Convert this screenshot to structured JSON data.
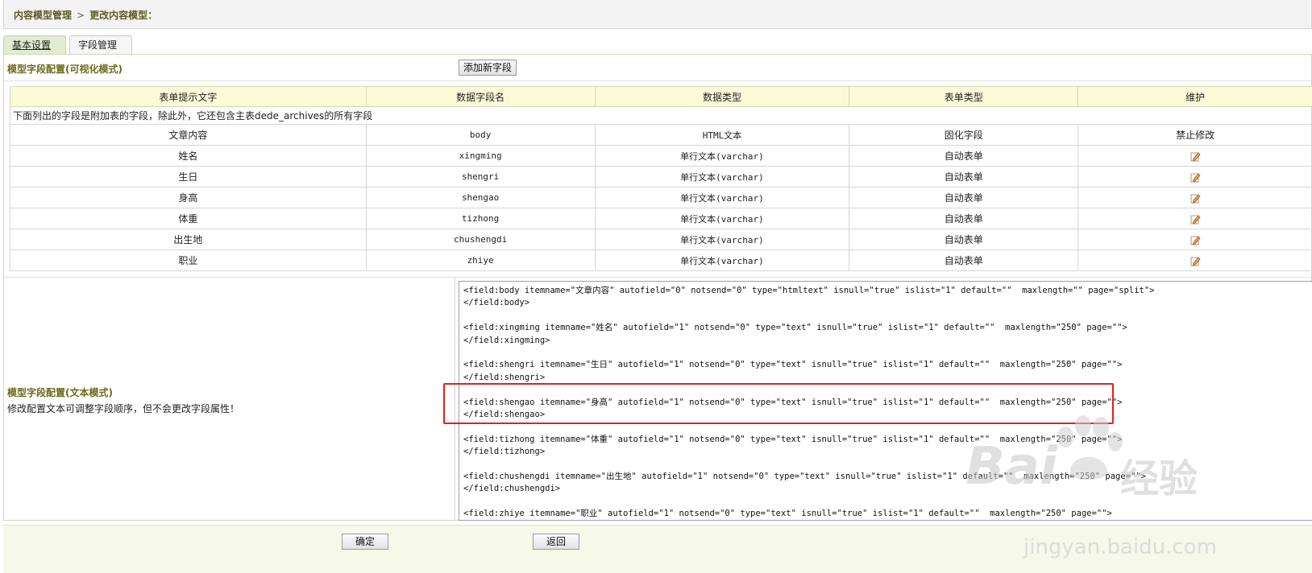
{
  "breadcrumb": {
    "item1": "内容模型管理",
    "separator": ">",
    "item2": "更改内容模型："
  },
  "tabs": [
    {
      "label": "基本设置",
      "active": true
    },
    {
      "label": "字段管理",
      "active": false
    }
  ],
  "visual_section": {
    "title": "模型字段配置(可视化模式)",
    "add_button": "添加新字段"
  },
  "fields_table": {
    "headers": [
      "表单提示文字",
      "数据字段名",
      "数据类型",
      "表单类型",
      "维护"
    ],
    "note": "下面列出的字段是附加表的字段，除此外，它还包含主表dede_archives的所有字段",
    "rows": [
      {
        "label": "文章内容",
        "field": "body",
        "type": "HTML文本",
        "form": "固化字段",
        "action": "禁止修改"
      },
      {
        "label": "姓名",
        "field": "xingming",
        "type": "单行文本(varchar)",
        "form": "自动表单",
        "action": ""
      },
      {
        "label": "生日",
        "field": "shengri",
        "type": "单行文本(varchar)",
        "form": "自动表单",
        "action": ""
      },
      {
        "label": "身高",
        "field": "shengao",
        "type": "单行文本(varchar)",
        "form": "自动表单",
        "action": ""
      },
      {
        "label": "体重",
        "field": "tizhong",
        "type": "单行文本(varchar)",
        "form": "自动表单",
        "action": ""
      },
      {
        "label": "出生地",
        "field": "chushengdi",
        "type": "单行文本(varchar)",
        "form": "自动表单",
        "action": ""
      },
      {
        "label": "职业",
        "field": "zhiye",
        "type": "单行文本(varchar)",
        "form": "自动表单",
        "action": ""
      }
    ]
  },
  "text_section": {
    "title": "模型字段配置(文本模式)",
    "description": "修改配置文本可调整字段顺序，但不会更改字段属性！",
    "code_lines": [
      "<field:body itemname=\"文章内容\" autofield=\"0\" notsend=\"0\" type=\"htmltext\" isnull=\"true\" islist=\"1\" default=\"\"  maxlength=\"\" page=\"split\">",
      "</field:body>",
      "",
      "<field:xingming itemname=\"姓名\" autofield=\"1\" notsend=\"0\" type=\"text\" isnull=\"true\" islist=\"1\" default=\"\"  maxlength=\"250\" page=\"\">",
      "</field:xingming>",
      "",
      "<field:shengri itemname=\"生日\" autofield=\"1\" notsend=\"0\" type=\"text\" isnull=\"true\" islist=\"1\" default=\"\"  maxlength=\"250\" page=\"\">",
      "</field:shengri>",
      "",
      "<field:shengao itemname=\"身高\" autofield=\"1\" notsend=\"0\" type=\"text\" isnull=\"true\" islist=\"1\" default=\"\"  maxlength=\"250\" page=\"\">",
      "</field:shengao>",
      "",
      "<field:tizhong itemname=\"体重\" autofield=\"1\" notsend=\"0\" type=\"text\" isnull=\"true\" islist=\"1\" default=\"\"  maxlength=\"250\" page=\"\">",
      "</field:tizhong>",
      "",
      "<field:chushengdi itemname=\"出生地\" autofield=\"1\" notsend=\"0\" type=\"text\" isnull=\"true\" islist=\"1\" default=\"\"  maxlength=\"250\" page=\"\">",
      "</field:chushengdi>",
      "",
      "<field:zhiye itemname=\"职业\" autofield=\"1\" notsend=\"0\" type=\"text\" isnull=\"true\" islist=\"1\" default=\"\"  maxlength=\"250\" page=\"\">"
    ]
  },
  "footer": {
    "ok_button": "确定",
    "back_button": "返回"
  },
  "watermark": {
    "brand": "Bai",
    "brand2": "经验",
    "url": "jingyan.baidu.com"
  },
  "colors": {
    "accent_title": "#6b6b1e",
    "header_bg": "#fbfbd8",
    "highlight": "#e02020"
  }
}
